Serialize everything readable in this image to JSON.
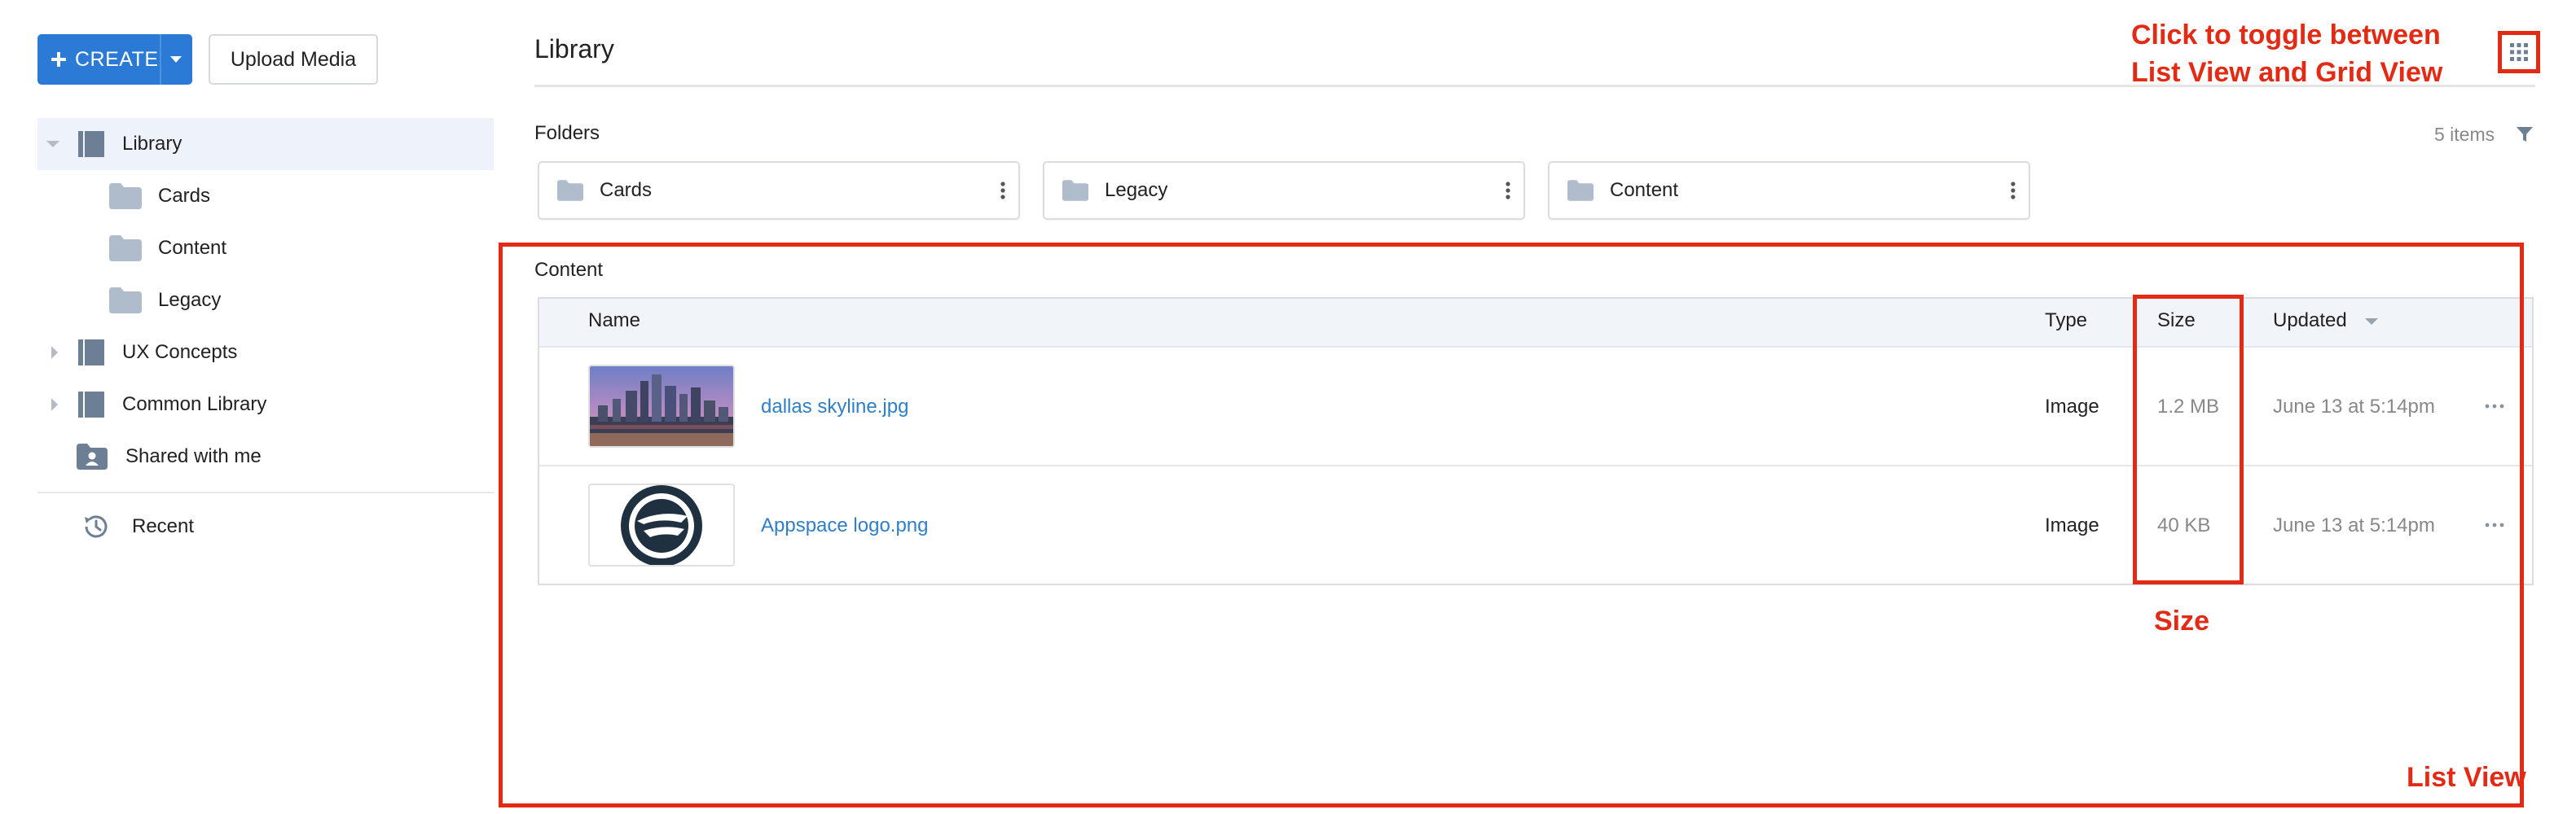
{
  "toolbar": {
    "create_label": "CREATE",
    "upload_label": "Upload Media"
  },
  "sidebar": {
    "items": [
      {
        "label": "Library"
      },
      {
        "label": "Cards"
      },
      {
        "label": "Content"
      },
      {
        "label": "Legacy"
      },
      {
        "label": "UX Concepts"
      },
      {
        "label": "Common Library"
      },
      {
        "label": "Shared with me"
      },
      {
        "label": "Recent"
      }
    ]
  },
  "header": {
    "title": "Library"
  },
  "folders": {
    "label": "Folders",
    "count": "5 items",
    "items": [
      {
        "name": "Cards"
      },
      {
        "name": "Legacy"
      },
      {
        "name": "Content"
      }
    ]
  },
  "content": {
    "label": "Content",
    "columns": {
      "name": "Name",
      "type": "Type",
      "size": "Size",
      "updated": "Updated"
    },
    "rows": [
      {
        "name": "dallas skyline.jpg",
        "type": "Image",
        "size": "1.2 MB",
        "updated": "June 13 at 5:14pm"
      },
      {
        "name": "Appspace logo.png",
        "type": "Image",
        "size": "40 KB",
        "updated": "June 13 at 5:14pm"
      }
    ]
  },
  "annotations": {
    "toggle_line1": "Click to toggle between",
    "toggle_line2": "List View and Grid View",
    "size": "Size",
    "list_view": "List View"
  },
  "colors": {
    "primary": "#2a7ad6",
    "annotation": "#e22a14",
    "link": "#2f7fc8",
    "selected_bg": "#eef3fb"
  }
}
